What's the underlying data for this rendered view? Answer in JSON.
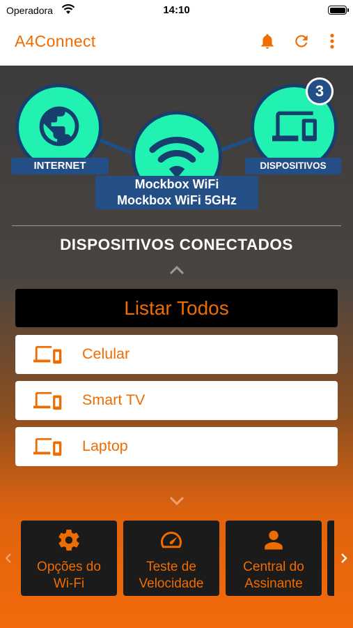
{
  "status_bar": {
    "carrier": "Operadora",
    "time": "14:10"
  },
  "header": {
    "title": "A4Connect",
    "icons": [
      "bell-icon",
      "refresh-icon",
      "more-vertical-icon"
    ],
    "accent_color": "#ef6c00"
  },
  "network": {
    "internet_label": "INTERNET",
    "devices_label": "DISPOSITIVOS",
    "devices_count": "3",
    "wifi_name_1": "Mockbox WiFi",
    "wifi_name_2": "Mockbox WiFi 5GHz",
    "circle_color": "#21f2b1",
    "tag_color": "#234f86"
  },
  "connected": {
    "title": "DISPOSITIVOS CONECTADOS",
    "list_all_label": "Listar Todos",
    "devices": [
      {
        "label": "Celular",
        "icon": "devices-icon"
      },
      {
        "label": "Smart TV",
        "icon": "devices-icon"
      },
      {
        "label": "Laptop",
        "icon": "devices-icon"
      }
    ]
  },
  "shortcuts": [
    {
      "line1": "Opções do",
      "line2": "Wi-Fi",
      "icon": "gear-icon"
    },
    {
      "line1": "Teste de",
      "line2": "Velocidade",
      "icon": "speedometer-icon"
    },
    {
      "line1": "Central do",
      "line2": "Assinante",
      "icon": "user-icon"
    }
  ]
}
